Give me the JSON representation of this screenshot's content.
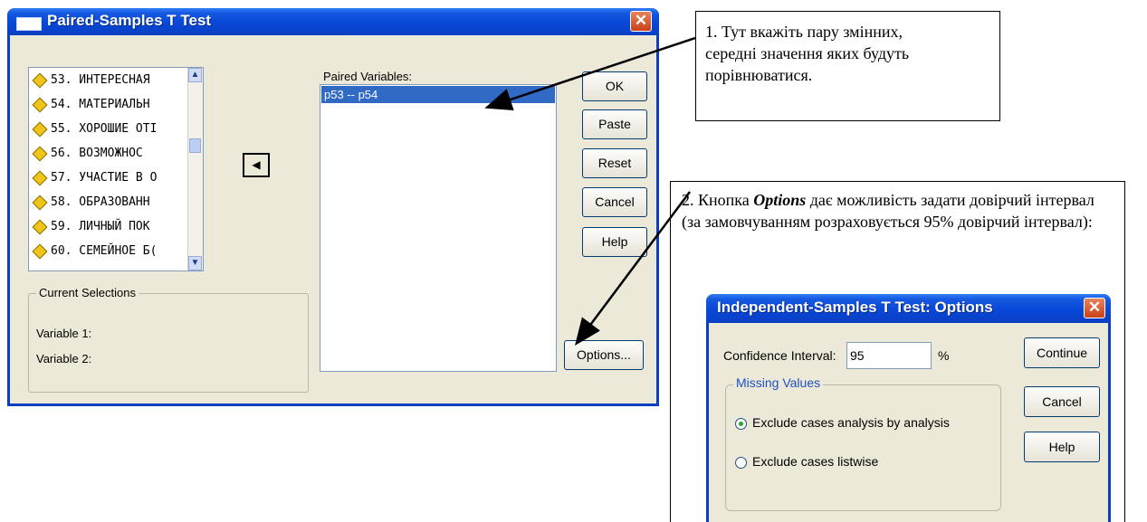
{
  "dialog": {
    "title": "Paired-Samples T Test",
    "close_glyph": "✕",
    "variables": [
      "53. ИНТЕРЕСНАЯ",
      "54. МАТЕРИАЛЬН",
      "55. ХОРОШИЕ ОТІ",
      "56. ВОЗМОЖНОС",
      "57. УЧАСТИЕ В О",
      "58. ОБРАЗОВАНН",
      "59. ЛИЧНЫЙ ПОК",
      "60. СЕМЕЙНОЕ Б("
    ],
    "move_glyph": "◀",
    "current_selections": {
      "legend": "Current Selections",
      "var1": "Variable 1:",
      "var2": "Variable 2:"
    },
    "paired_label": "Paired Variables:",
    "pairs": [
      "p53 -- p54"
    ],
    "buttons": {
      "ok": "OK",
      "paste": "Paste",
      "reset": "Reset",
      "cancel": "Cancel",
      "help": "Help",
      "options": "Options..."
    }
  },
  "callouts": {
    "note1": [
      "1. Тут вкажіть пару змінних,",
      "середні значення яких будуть",
      "порівнюватися."
    ],
    "note2_prefix": "2. Кнопка ",
    "note2_bold": "Options",
    "note2_rest": "  дає можливість задати довірчий інтервал (за замовчуванням розраховується 95% довірчий інтервал):"
  },
  "options_dialog": {
    "title": "Independent-Samples T Test: Options",
    "ci_label": "Confidence Interval:",
    "ci_value": "95",
    "ci_unit": "%",
    "missing_values_legend": "Missing Values",
    "radio1": "Exclude cases analysis by analysis",
    "radio2": "Exclude cases listwise",
    "radio1_selected": true,
    "buttons": {
      "continue": "Continue",
      "cancel": "Cancel",
      "help": "Help"
    }
  }
}
